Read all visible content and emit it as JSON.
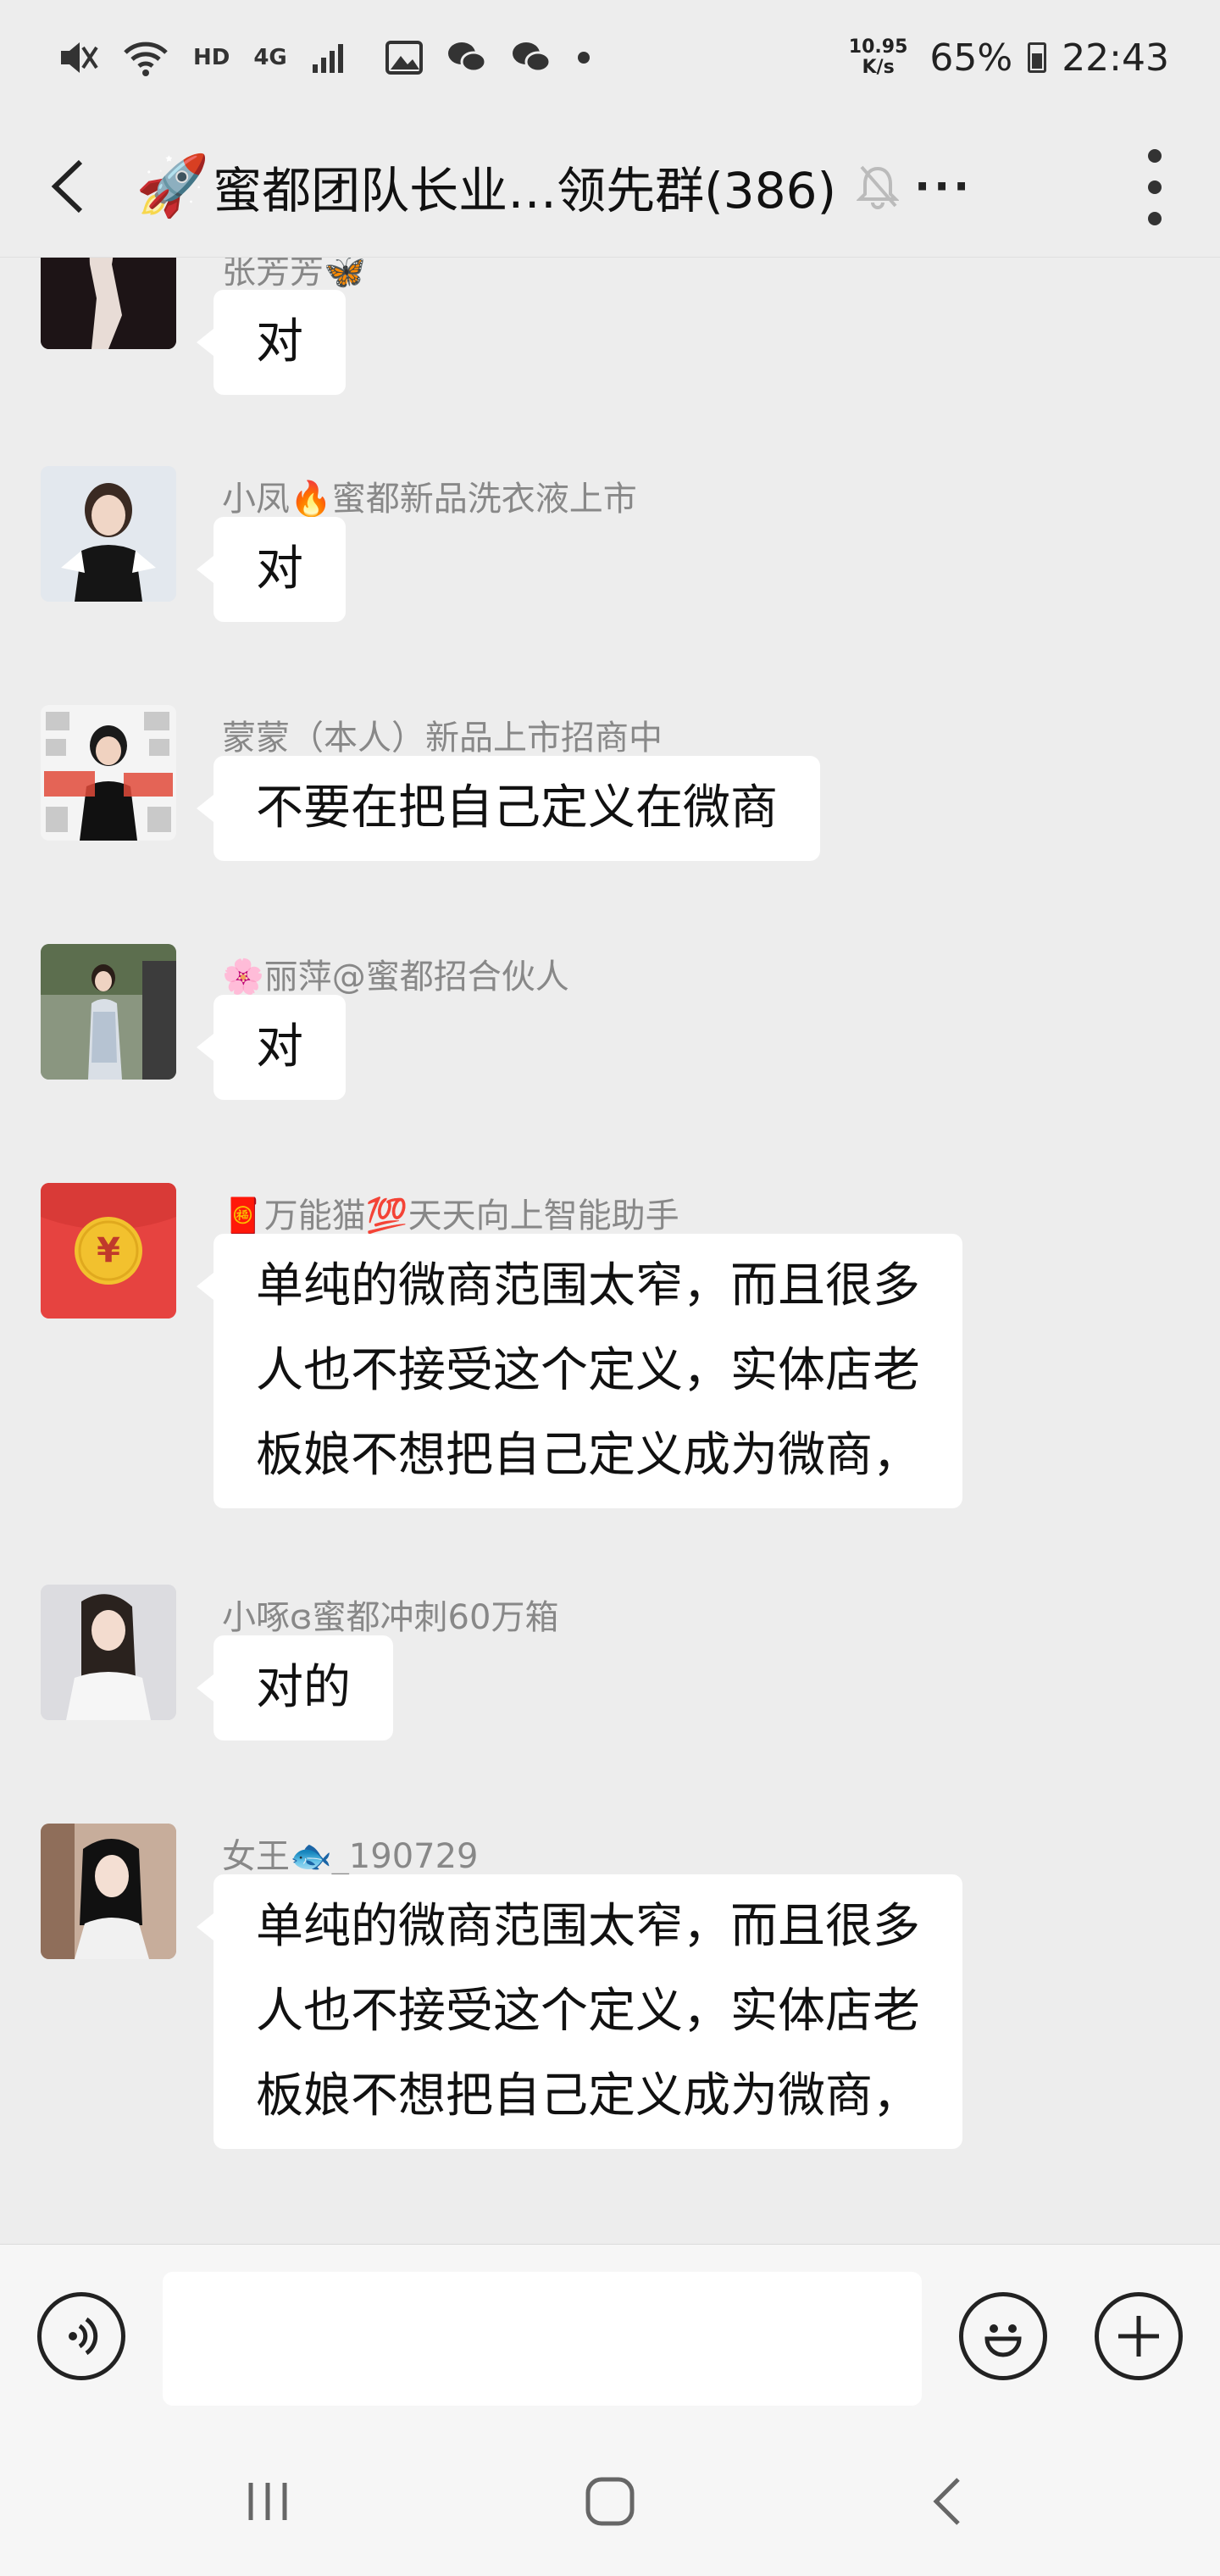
{
  "status_bar": {
    "hd_label": "HD",
    "network_label": "4G",
    "speed_value": "10.95",
    "speed_unit": "K/s",
    "battery": "65%",
    "time": "22:43"
  },
  "header": {
    "title": "蜜都团队长业…领先群(386)",
    "title_emoji": "🚀",
    "ellipsis": "···"
  },
  "messages": [
    {
      "sender": "张芳芳🦋",
      "text": "对",
      "avatar": "woman-in-black-dress"
    },
    {
      "sender": "小凤🔥蜜都新品洗衣液上市",
      "text": "对",
      "avatar": "woman-black-dress-white-sleeves"
    },
    {
      "sender": "蒙蒙（本人）新品上市招商中",
      "text": "不要在把自己定义在微商",
      "avatar": "poster-woman"
    },
    {
      "sender": "🌸丽萍@蜜都招合伙人",
      "text": "对",
      "avatar": "woman-qipao"
    },
    {
      "sender": "🧧万能猫💯天天向上智能助手",
      "text": "单纯的微商范围太窄，而且很多人也不接受这个定义，实体店老板娘不想把自己定义成为微商，",
      "avatar_symbol": "¥",
      "avatar": "red-envelope"
    },
    {
      "sender": "小啄ɞ蜜都冲刺60万箱",
      "text": "对的",
      "avatar": "woman-white-top"
    },
    {
      "sender": "女王🐟_190729",
      "text": "单纯的微商范围太窄，而且很多人也不接受这个定义，实体店老板娘不想把自己定义成为微商，",
      "avatar": "woman-dark-hair"
    }
  ],
  "bubble_lines": {
    "long_1": [
      "单纯的微商范围太窄，而且很多",
      "人也不接受这个定义，实体店老",
      "板娘不想把自己定义成为微商，"
    ]
  },
  "input": {
    "value": "",
    "voice_icon": "voice-icon",
    "emoji_icon": "emoji-icon",
    "plus_icon": "plus-icon"
  },
  "colors": {
    "background": "#ededed",
    "bubble": "#ffffff",
    "sender_text": "#888888",
    "red_envelope": "#e64340",
    "coin": "#f2c12e"
  }
}
